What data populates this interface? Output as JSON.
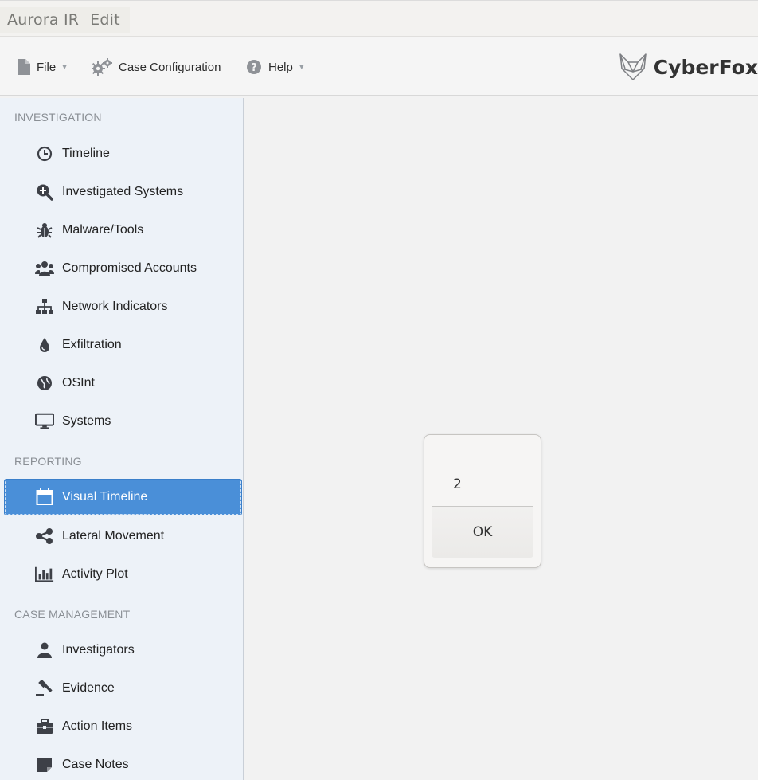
{
  "menubar": {
    "app_name": "Aurora IR",
    "edit_label": "Edit"
  },
  "toolbar": {
    "file_label": "File",
    "case_config_label": "Case Configuration",
    "help_label": "Help",
    "brand": "CyberFox"
  },
  "sidebar": {
    "sections": [
      {
        "title": "INVESTIGATION",
        "items": [
          {
            "label": "Timeline",
            "icon": "clock-icon"
          },
          {
            "label": "Investigated Systems",
            "icon": "zoom-in-icon"
          },
          {
            "label": "Malware/Tools",
            "icon": "bug-icon"
          },
          {
            "label": "Compromised Accounts",
            "icon": "users-icon"
          },
          {
            "label": "Network Indicators",
            "icon": "sitemap-icon"
          },
          {
            "label": "Exfiltration",
            "icon": "drop-icon"
          },
          {
            "label": "OSInt",
            "icon": "globe-icon"
          },
          {
            "label": "Systems",
            "icon": "desktop-icon"
          }
        ]
      },
      {
        "title": "REPORTING",
        "items": [
          {
            "label": "Visual Timeline",
            "icon": "calendar-icon",
            "active": true
          },
          {
            "label": "Lateral Movement",
            "icon": "share-icon"
          },
          {
            "label": "Activity Plot",
            "icon": "bar-chart-icon"
          }
        ]
      },
      {
        "title": "CASE MANAGEMENT",
        "items": [
          {
            "label": "Investigators",
            "icon": "user-icon"
          },
          {
            "label": "Evidence",
            "icon": "gavel-icon"
          },
          {
            "label": "Action Items",
            "icon": "briefcase-icon"
          },
          {
            "label": "Case Notes",
            "icon": "sticky-note-icon"
          }
        ]
      }
    ]
  },
  "dialog": {
    "message": "2",
    "ok_label": "OK"
  },
  "colors": {
    "active_item": "#4a8fd8",
    "sidebar_bg": "#edf2f8",
    "icon": "#3d4047"
  }
}
